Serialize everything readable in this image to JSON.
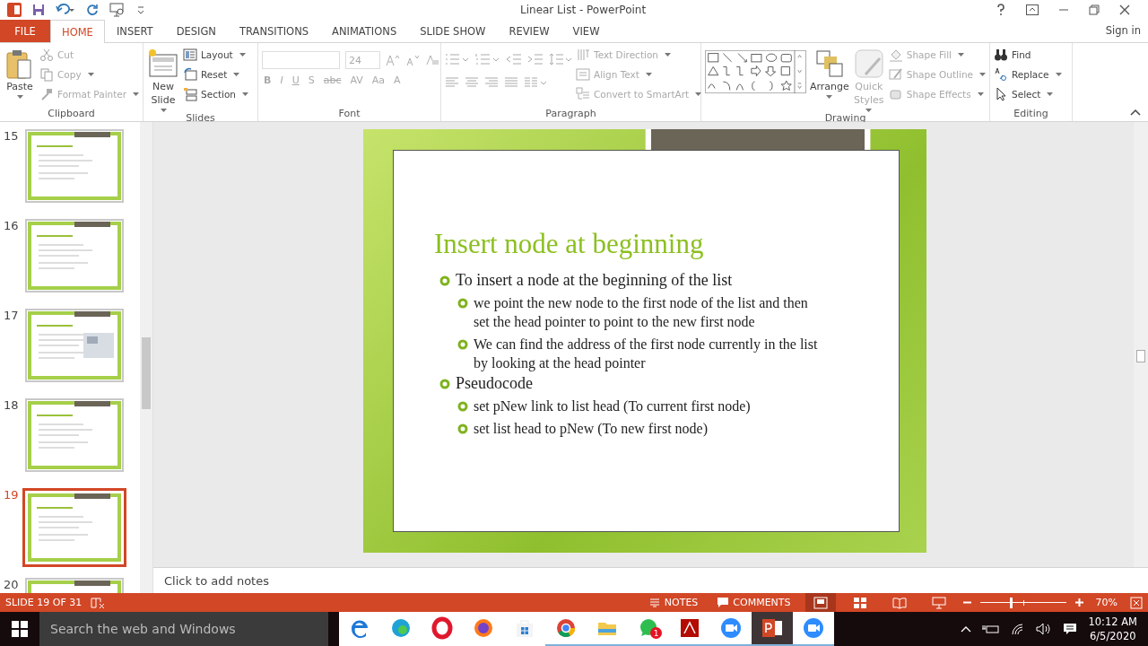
{
  "window": {
    "title": "Linear List - PowerPoint",
    "account": "Sign in"
  },
  "tabs": [
    {
      "label": "FILE",
      "kind": "file",
      "selected": false
    },
    {
      "label": "HOME",
      "kind": "tab",
      "selected": true
    },
    {
      "label": "INSERT",
      "kind": "tab",
      "selected": false
    },
    {
      "label": "DESIGN",
      "kind": "tab",
      "selected": false
    },
    {
      "label": "TRANSITIONS",
      "kind": "tab",
      "selected": false
    },
    {
      "label": "ANIMATIONS",
      "kind": "tab",
      "selected": false
    },
    {
      "label": "SLIDE SHOW",
      "kind": "tab",
      "selected": false
    },
    {
      "label": "REVIEW",
      "kind": "tab",
      "selected": false
    },
    {
      "label": "VIEW",
      "kind": "tab",
      "selected": false
    }
  ],
  "ribbon": {
    "groups": [
      {
        "kind": "clipboard",
        "label": "Clipboard",
        "big": [
          {
            "label": "Paste",
            "kind": "paste",
            "disabled": false
          }
        ],
        "items": [
          {
            "label": "Cut",
            "kind": "cut",
            "disabled": true
          },
          {
            "label": "Copy",
            "kind": "copy",
            "disabled": true
          },
          {
            "label": "Format Painter",
            "kind": "brush",
            "disabled": true
          }
        ]
      },
      {
        "kind": "slides",
        "label": "Slides",
        "big": [
          {
            "label": "New Slide",
            "kind": "slide",
            "disabled": false
          }
        ],
        "items": [
          {
            "label": "Layout",
            "kind": "layout",
            "disabled": false
          },
          {
            "label": "Reset",
            "kind": "reset",
            "disabled": false
          },
          {
            "label": "Section",
            "kind": "section",
            "disabled": false
          }
        ]
      },
      {
        "kind": "font",
        "label": "Font",
        "font_size": "24",
        "disabled": true,
        "formats": [
          "B",
          "I",
          "U",
          "S",
          "abc",
          "AV",
          "Aa",
          "A"
        ]
      },
      {
        "kind": "paragraph",
        "label": "Paragraph",
        "items": [
          {
            "label": "Text Direction",
            "kind": "direction",
            "disabled": true
          },
          {
            "label": "Align Text",
            "kind": "align",
            "disabled": true
          },
          {
            "label": "Convert to SmartArt",
            "kind": "smartart",
            "disabled": true
          }
        ]
      },
      {
        "kind": "drawing",
        "label": "Drawing",
        "big": [
          {
            "label": "Arrange",
            "kind": "arrange",
            "disabled": false
          },
          {
            "label": "Quick Styles",
            "kind": "styles",
            "disabled": true
          }
        ],
        "items": [
          {
            "label": "Shape Fill",
            "kind": "fill",
            "disabled": true
          },
          {
            "label": "Shape Outline",
            "kind": "outline",
            "disabled": true
          },
          {
            "label": "Shape Effects",
            "kind": "effects",
            "disabled": true
          }
        ]
      },
      {
        "kind": "editing",
        "label": "Editing",
        "items": [
          {
            "label": "Find",
            "kind": "find",
            "disabled": false
          },
          {
            "label": "Replace",
            "kind": "replace",
            "disabled": false
          },
          {
            "label": "Select",
            "kind": "select",
            "disabled": false
          }
        ]
      }
    ]
  },
  "thumbnails": [
    {
      "number": "15",
      "kind": "text",
      "selected": false
    },
    {
      "number": "16",
      "kind": "text",
      "selected": false
    },
    {
      "number": "17",
      "kind": "image",
      "selected": false
    },
    {
      "number": "18",
      "kind": "text",
      "selected": false
    },
    {
      "number": "19",
      "kind": "text",
      "selected": true
    },
    {
      "number": "20",
      "kind": "text",
      "selected": false
    }
  ],
  "slide": {
    "title": "Insert node at beginning",
    "bullets": [
      {
        "text": "To insert a node at the beginning of the list",
        "children": [
          {
            "text": "we point the new node to the first node of the list and then set the head pointer to point to the new first node"
          },
          {
            "text": "We can find the address of the first node currently in the list  by looking at the head pointer"
          }
        ]
      },
      {
        "text": "Pseudocode",
        "children": [
          {
            "text": "set pNew link to list head (To current first node)"
          },
          {
            "text": "set list head to pNew (To new first node)"
          }
        ]
      }
    ]
  },
  "notes": {
    "placeholder": "Click to add notes"
  },
  "status_bar": {
    "slide_info": "SLIDE 19 OF 31",
    "notes": "NOTES",
    "comments": "COMMENTS",
    "views": [
      {
        "kind": "normal",
        "selected": true
      },
      {
        "kind": "sorter",
        "selected": false
      },
      {
        "kind": "reading",
        "selected": false
      },
      {
        "kind": "show",
        "selected": false
      }
    ],
    "zoom": {
      "level": 0.35,
      "reading": "70%"
    }
  },
  "taskbar": {
    "search": {
      "placeholder": "Search the web and Windows"
    },
    "apps": [
      {
        "kind": "edge-old",
        "running": false,
        "selected": false
      },
      {
        "kind": "edge",
        "running": false,
        "selected": false
      },
      {
        "kind": "opera",
        "running": false,
        "selected": false
      },
      {
        "kind": "firefox",
        "running": false,
        "selected": false
      },
      {
        "kind": "store",
        "running": false,
        "selected": false
      },
      {
        "kind": "chrome",
        "running": true,
        "selected": false
      },
      {
        "kind": "folder",
        "running": true,
        "selected": false
      },
      {
        "kind": "whatsapp",
        "running": true,
        "selected": false,
        "badge": "1"
      },
      {
        "kind": "acrobat",
        "running": true,
        "selected": false
      },
      {
        "kind": "zoom",
        "running": true,
        "selected": false
      },
      {
        "kind": "powerpoint",
        "running": true,
        "selected": true
      },
      {
        "kind": "zoom",
        "running": true,
        "selected": false
      }
    ],
    "time": "10:12 AM",
    "date": "6/5/2020"
  }
}
